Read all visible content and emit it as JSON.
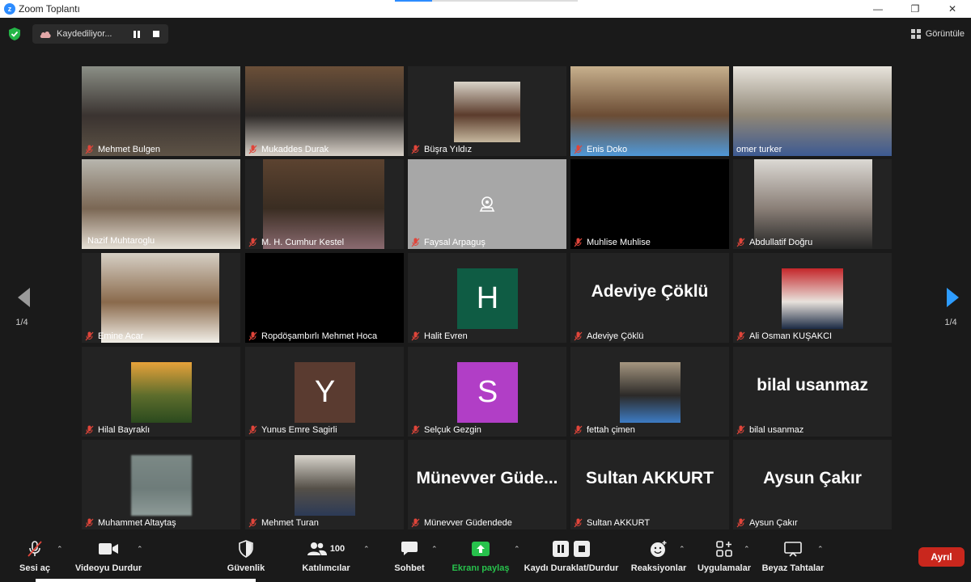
{
  "window": {
    "title": "Zoom Toplantı",
    "minimize": "—",
    "restore": "❐",
    "close": "✕"
  },
  "top": {
    "recording_label": "Kaydediliyor...",
    "view_label": "Görüntüle"
  },
  "colors": {
    "accent": "#2d8cff",
    "speaker_border": "#e8e66a",
    "leave": "#c9271d",
    "share": "#27c24c",
    "mic_muted": "#e0453a"
  },
  "participants": [
    {
      "name": "Mehmet Bulgen",
      "type": "video"
    },
    {
      "name": "Mukaddes Durak",
      "type": "video"
    },
    {
      "name": "Büşra Yıldız",
      "type": "video"
    },
    {
      "name": "Enis Doko",
      "type": "video"
    },
    {
      "name": "omer turker",
      "type": "video",
      "mic": "on"
    },
    {
      "name": "Nazif Muhtaroglu",
      "type": "video",
      "mic": "on",
      "speaking": true
    },
    {
      "name": "M. H. Cumhur Kestel",
      "type": "video"
    },
    {
      "name": "Faysal Arpaguş",
      "type": "placeholder"
    },
    {
      "name": "Muhlise Muhlise",
      "type": "black"
    },
    {
      "name": "Abdullatif Doğru",
      "type": "video"
    },
    {
      "name": "Emine Acar",
      "type": "video"
    },
    {
      "name": "Ropdöşambırlı Mehmet Hoca",
      "type": "black"
    },
    {
      "name": "Halit Evren",
      "type": "letter",
      "letter": "H",
      "color": "#0f5c44"
    },
    {
      "name": "Adeviye Çöklü",
      "type": "bigname",
      "display": "Adeviye Çöklü"
    },
    {
      "name": "Ali Osman KUŞAKCI",
      "type": "photo"
    },
    {
      "name": "Hilal Bayraklı",
      "type": "photo"
    },
    {
      "name": "Yunus Emre Sagirli",
      "type": "letter",
      "letter": "Y",
      "color": "#5a3b30"
    },
    {
      "name": "Selçuk Gezgin",
      "type": "letter",
      "letter": "S",
      "color": "#b13ec6"
    },
    {
      "name": "fettah çimen",
      "type": "photo"
    },
    {
      "name": "bilal usanmaz",
      "type": "bigname",
      "display": "bilal usanmaz"
    },
    {
      "name": "Muhammet Altaytaş",
      "type": "photo"
    },
    {
      "name": "Mehmet Turan",
      "type": "photo"
    },
    {
      "name": "Münevver Güdendede",
      "type": "bigname",
      "display": "Münevver Güde..."
    },
    {
      "name": "Sultan AKKURT",
      "type": "bigname",
      "display": "Sultan AKKURT"
    },
    {
      "name": "Aysun Çakır",
      "type": "bigname",
      "display": "Aysun Çakır"
    }
  ],
  "pagination": {
    "left": "1/4",
    "right": "1/4"
  },
  "toolbar": {
    "unmute": "Sesi aç",
    "stop_video": "Videoyu Durdur",
    "security": "Güvenlik",
    "participants": "Katılımcılar",
    "participants_count": "100",
    "chat": "Sohbet",
    "share": "Ekranı paylaş",
    "record": "Kaydı Duraklat/Durdur",
    "reactions": "Reaksiyonlar",
    "apps": "Uygulamalar",
    "whiteboards": "Beyaz Tahtalar",
    "leave": "Ayrıl"
  }
}
